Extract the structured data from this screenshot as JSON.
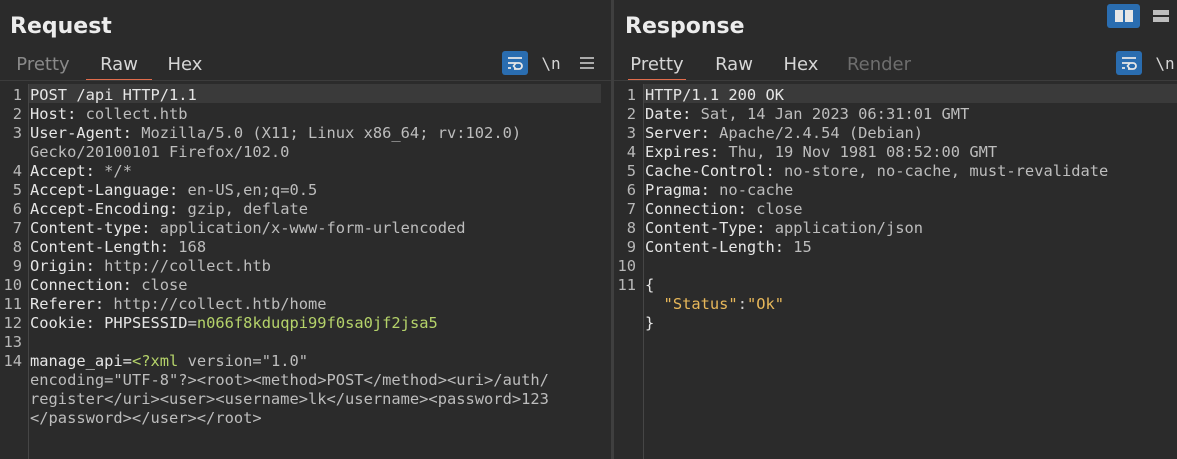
{
  "request": {
    "title": "Request",
    "tabs": [
      "Pretty",
      "Raw",
      "Hex"
    ],
    "active_tab": "Raw",
    "toolbar": {
      "newline_label": "\\n"
    },
    "lines": [
      {
        "n": "1",
        "key": "POST /api HTTP/1.1",
        "sep": "",
        "val": ""
      },
      {
        "n": "2",
        "key": "Host",
        "sep": ": ",
        "val": "collect.htb"
      },
      {
        "n": "3",
        "key": "User-Agent",
        "sep": ": ",
        "val": "Mozilla/5.0 (X11; Linux x86_64; rv:102.0)"
      },
      {
        "n": "",
        "key": "",
        "sep": "",
        "val": "Gecko/20100101 Firefox/102.0"
      },
      {
        "n": "4",
        "key": "Accept",
        "sep": ": ",
        "val": "*/*"
      },
      {
        "n": "5",
        "key": "Accept-Language",
        "sep": ": ",
        "val": "en-US,en;q=0.5"
      },
      {
        "n": "6",
        "key": "Accept-Encoding",
        "sep": ": ",
        "val": "gzip, deflate"
      },
      {
        "n": "7",
        "key": "Content-type",
        "sep": ": ",
        "val": "application/x-www-form-urlencoded"
      },
      {
        "n": "8",
        "key": "Content-Length",
        "sep": ": ",
        "val": "168"
      },
      {
        "n": "9",
        "key": "Origin",
        "sep": ": ",
        "val": "http://collect.htb"
      },
      {
        "n": "10",
        "key": "Connection",
        "sep": ": ",
        "val": "close"
      },
      {
        "n": "11",
        "key": "Referer",
        "sep": ": ",
        "val": "http://collect.htb/home"
      },
      {
        "n": "12",
        "key": "Cookie",
        "sep": ": ",
        "val": "PHPSESSID",
        "eq": "=",
        "val2": "n066f8kduqpi99f0sa0jf2jsa5"
      },
      {
        "n": "13",
        "key": "",
        "sep": "",
        "val": ""
      },
      {
        "n": "14",
        "key": "manage_api",
        "sep": "=",
        "val": "<?xml",
        "rest": " version=\"1.0\""
      },
      {
        "n": "",
        "key": "",
        "sep": "",
        "val": "",
        "rest": "encoding=\"UTF-8\"?><root><method>POST</method><uri>/auth/"
      },
      {
        "n": "",
        "key": "",
        "sep": "",
        "val": "",
        "rest": "register</uri><user><username>lk</username><password>123"
      },
      {
        "n": "",
        "key": "",
        "sep": "",
        "val": "",
        "rest": "</password></user></root>"
      }
    ]
  },
  "response": {
    "title": "Response",
    "tabs": [
      "Pretty",
      "Raw",
      "Hex",
      "Render"
    ],
    "active_tab": "Pretty",
    "toolbar": {
      "newline_label": "\\n"
    },
    "lines": [
      {
        "n": "1",
        "key": "HTTP/1.1 200 OK",
        "sep": "",
        "val": ""
      },
      {
        "n": "2",
        "key": "Date",
        "sep": ": ",
        "val": "Sat, 14 Jan 2023 06:31:01 GMT"
      },
      {
        "n": "3",
        "key": "Server",
        "sep": ": ",
        "val": "Apache/2.4.54 (Debian)"
      },
      {
        "n": "4",
        "key": "Expires",
        "sep": ": ",
        "val": "Thu, 19 Nov 1981 08:52:00 GMT"
      },
      {
        "n": "5",
        "key": "Cache-Control",
        "sep": ": ",
        "val": "no-store, no-cache, must-revalidate"
      },
      {
        "n": "6",
        "key": "Pragma",
        "sep": ": ",
        "val": "no-cache"
      },
      {
        "n": "7",
        "key": "Connection",
        "sep": ": ",
        "val": "close"
      },
      {
        "n": "8",
        "key": "Content-Type",
        "sep": ": ",
        "val": "application/json"
      },
      {
        "n": "9",
        "key": "Content-Length",
        "sep": ": ",
        "val": "15"
      },
      {
        "n": "10",
        "key": "",
        "sep": "",
        "val": ""
      },
      {
        "n": "11",
        "key": "{",
        "sep": "",
        "val": ""
      },
      {
        "n": "",
        "key": "  ",
        "sep": "",
        "val": "",
        "jk": "\"Status\"",
        "jc": ":",
        "jv": "\"Ok\""
      },
      {
        "n": "",
        "key": "}",
        "sep": "",
        "val": ""
      }
    ]
  }
}
